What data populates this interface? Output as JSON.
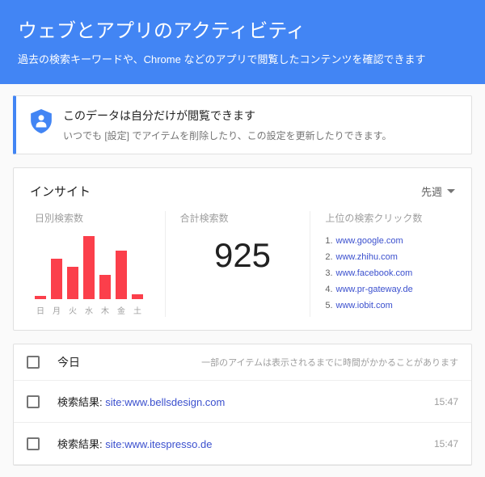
{
  "header": {
    "title": "ウェブとアプリのアクティビティ",
    "subtitle": "過去の検索キーワードや、Chrome などのアプリで閲覧したコンテンツを確認できます"
  },
  "privacy": {
    "title": "このデータは自分だけが閲覧できます",
    "subtitle": "いつでも [設定] でアイテムを削除したり、この設定を更新したりできます。"
  },
  "insights": {
    "title": "インサイト",
    "period": "先週",
    "daily_label": "日別検索数",
    "total_label": "合計検索数",
    "total_value": "925",
    "top_label": "上位の検索クリック数",
    "days": [
      "日",
      "月",
      "火",
      "水",
      "木",
      "金",
      "土"
    ],
    "top_sites": [
      "www.google.com",
      "www.zhihu.com",
      "www.facebook.com",
      "www.pr-gateway.de",
      "www.iobit.com"
    ]
  },
  "list": {
    "section": "今日",
    "note": "一部のアイテムは表示されるまでに時間がかかることがあります",
    "items": [
      {
        "prefix": "検索結果: ",
        "query": "site:www.bellsdesign.com",
        "time": "15:47"
      },
      {
        "prefix": "検索結果: ",
        "query": "site:www.itespresso.de",
        "time": "15:47"
      }
    ]
  },
  "chart_data": {
    "type": "bar",
    "categories": [
      "日",
      "月",
      "火",
      "水",
      "木",
      "金",
      "土"
    ],
    "values": [
      4,
      50,
      40,
      78,
      30,
      60,
      6
    ],
    "title": "日別検索数",
    "xlabel": "",
    "ylabel": "",
    "ylim": [
      0,
      80
    ]
  }
}
